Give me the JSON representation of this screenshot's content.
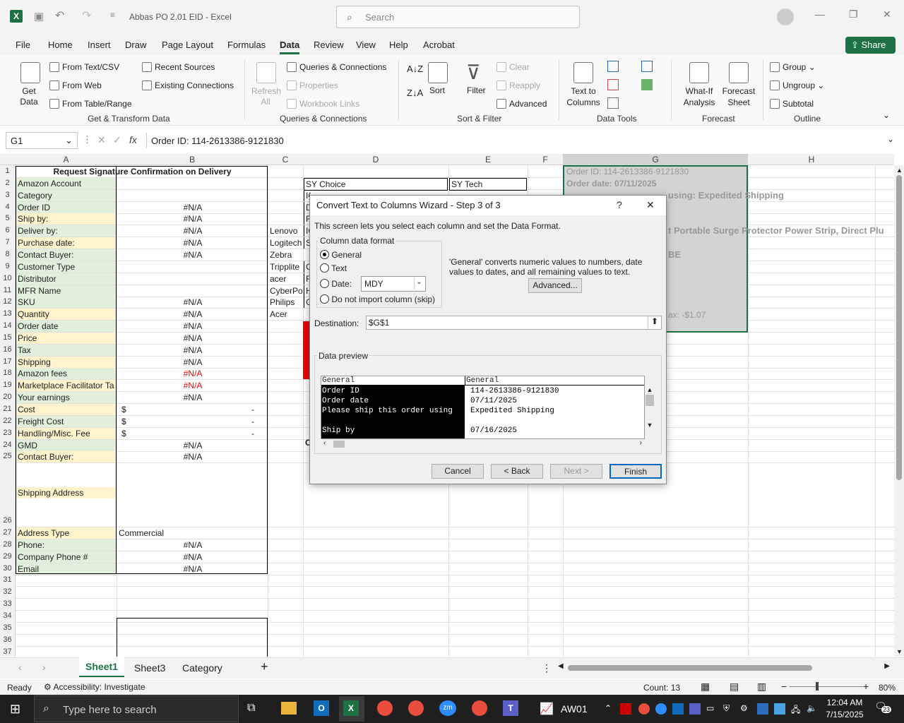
{
  "app": {
    "title": "Abbas PO 2.01 EID  -  Excel",
    "search_placeholder": "Search"
  },
  "menu_tabs": [
    "File",
    "Home",
    "Insert",
    "Draw",
    "Page Layout",
    "Formulas",
    "Data",
    "Review",
    "View",
    "Help",
    "Acrobat"
  ],
  "share_label": "Share",
  "ribbon": {
    "get_data": "Get Data",
    "from_text": "From Text/CSV",
    "from_web": "From Web",
    "from_table": "From Table/Range",
    "recent_sources": "Recent Sources",
    "existing_connections": "Existing Connections",
    "refresh_all": "Refresh All",
    "queries_connections": "Queries & Connections",
    "properties": "Properties",
    "workbook_links": "Workbook Links",
    "sort": "Sort",
    "filter": "Filter",
    "clear": "Clear",
    "reapply": "Reapply",
    "advanced": "Advanced",
    "text_to_columns": "Text to Columns",
    "what_if": "What-If Analysis",
    "forecast_sheet": "Forecast Sheet",
    "group": "Group",
    "ungroup": "Ungroup",
    "subtotal": "Subtotal",
    "groups": [
      "Get & Transform Data",
      "Queries & Connections",
      "Sort & Filter",
      "Data Tools",
      "Forecast",
      "Outline"
    ]
  },
  "namebox": "G1",
  "formula": "Order ID: 114-2613386-9121830",
  "columns": [
    "A",
    "B",
    "C",
    "D",
    "E",
    "F",
    "G",
    "H"
  ],
  "rows": [
    "1",
    "2",
    "3",
    "4",
    "5",
    "6",
    "7",
    "8",
    "9",
    "10",
    "11",
    "12",
    "13",
    "14",
    "15",
    "16",
    "17",
    "18",
    "19",
    "20",
    "21",
    "22",
    "23",
    "24",
    "25",
    "26",
    "27",
    "28",
    "29",
    "30",
    "31",
    "32",
    "33",
    "34",
    "35",
    "36",
    "37"
  ],
  "sheet": {
    "a1": "Request Signature Confirmation on Delivery",
    "a_labels": [
      "Amazon Account",
      "Category",
      "Order ID",
      "Ship by:",
      "Deliver by:",
      "Purchase date:",
      "Contact Buyer:",
      "Customer Type",
      "Distributor",
      "MFR Name",
      "SKU",
      "Quantity",
      "Order date",
      "Price",
      "Tax",
      "Shipping",
      "Amazon fees",
      "Marketplace Facilitator Ta",
      "Your earnings",
      "Cost",
      "Freight Cost",
      "Handling/Misc. Fee",
      "GMD",
      "Contact Buyer:"
    ],
    "shipping_address": "Shipping Address",
    "a_labels2": [
      "Address Type",
      "Phone:",
      "Company Phone #",
      "Email"
    ],
    "na": "#N/A",
    "dollar": "$",
    "dash": "-",
    "commercial": "Commercial",
    "c_vals": [
      "Lenovo",
      "Logitech",
      "Zebra",
      "Tripplite",
      "acer",
      "CyberPow",
      "Philips",
      "Acer"
    ],
    "d1": "SY Choice",
    "e1": "SY Tech",
    "d_frag": [
      "IC",
      "D",
      "F",
      "IC",
      "S",
      "C",
      "F",
      "H",
      "G"
    ],
    "d24": "O",
    "g1": "Order ID: 114-2613386-9121830",
    "g2": "Order date: 07/11/2025",
    "g3": "using: Expedited Shipping",
    "g6": "t Portable Surge Protector Power Strip, Direct Plu",
    "g8": "BE",
    "g13": "ax: -$1.07"
  },
  "dialog": {
    "title": "Convert Text to Columns Wizard - Step 3 of 3",
    "help": "?",
    "close": "✕",
    "intro": "This screen lets you select each column and set the Data Format.",
    "fmt_group": "Column data format",
    "opt_general": "General",
    "opt_text": "Text",
    "opt_date": "Date:",
    "date_value": "MDY",
    "opt_skip": "Do not import column (skip)",
    "desc": "'General' converts numeric values to numbers, date values to dates, and all remaining values to text.",
    "advanced_btn": "Advanced...",
    "dest_label": "Destination:",
    "dest_value": "$G$1",
    "preview_label": "Data preview",
    "preview_hdr": [
      "General",
      "General"
    ],
    "preview_col1": [
      "Order ID",
      "Order date",
      "Please ship this order using",
      "",
      "Ship by"
    ],
    "preview_col2": [
      "114-2613386-9121830",
      "07/11/2025",
      "Expedited Shipping",
      "",
      "07/16/2025"
    ],
    "cancel": "Cancel",
    "back": "< Back",
    "next": "Next >",
    "finish": "Finish"
  },
  "sheet_tabs": [
    "Sheet1",
    "Sheet3",
    "Category"
  ],
  "status": {
    "ready": "Ready",
    "accessibility": "Accessibility: Investigate",
    "count": "Count: 13",
    "zoom": "80%"
  },
  "taskbar": {
    "search": "Type here to search",
    "time": "12:04 AM",
    "date": "7/15/2025",
    "aw": "AW01",
    "badge": "23"
  }
}
